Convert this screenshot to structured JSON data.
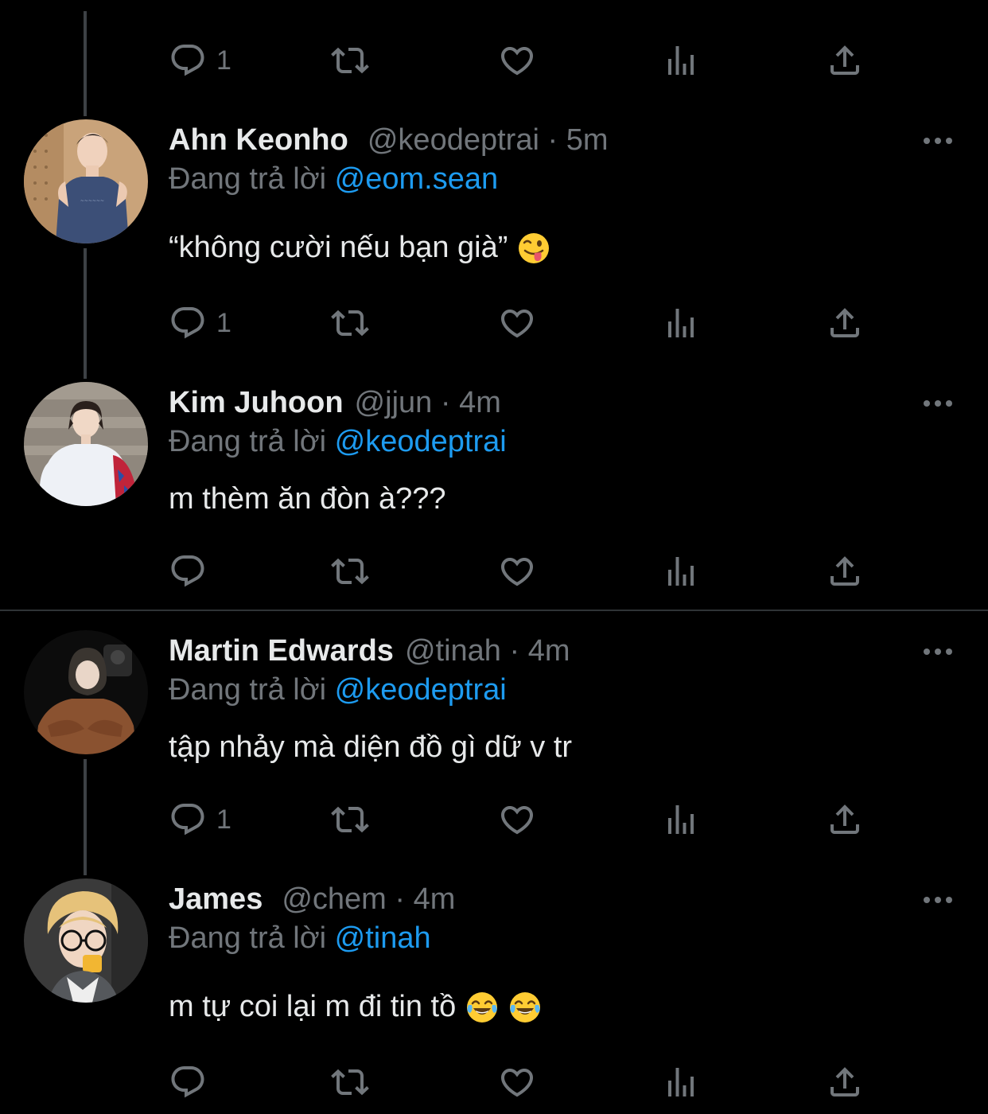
{
  "colors": {
    "background": "#000000",
    "text": "#e7e9ea",
    "muted": "#71767b",
    "accent": "#1d9bf0",
    "thread_line": "#3d4145"
  },
  "icons": [
    "reply-icon",
    "retweet-icon",
    "like-icon",
    "analytics-icon",
    "share-icon",
    "more-icon"
  ],
  "top_actions": {
    "reply_count": "1"
  },
  "tweets": [
    {
      "name": "Ahn Keonho",
      "handle": "@keodeptrai",
      "time": "5m",
      "reply_prefix": "Đang trả lời",
      "reply_to": "@eom.sean",
      "text": "“không cười nếu bạn già”",
      "emojis": [
        "winking-face-with-tongue"
      ],
      "reply_count": "1"
    },
    {
      "name": "Kim Juhoon",
      "handle": "@jjun",
      "time": "4m",
      "reply_prefix": "Đang trả lời",
      "reply_to": "@keodeptrai",
      "text": "m thèm ăn đòn à???",
      "emojis": [],
      "reply_count": ""
    },
    {
      "name": "Martin Edwards",
      "handle": "@tinah",
      "time": "4m",
      "reply_prefix": "Đang trả lời",
      "reply_to": "@keodeptrai",
      "text": "tập nhảy mà diện đồ gì dữ v tr",
      "emojis": [],
      "reply_count": "1"
    },
    {
      "name": "James",
      "handle": "@chem",
      "time": "4m",
      "reply_prefix": "Đang trả lời",
      "reply_to": "@tinah",
      "text": "m tự coi lại m đi tin tồ",
      "emojis": [
        "face-with-tears-of-joy",
        "face-with-tears-of-joy"
      ],
      "reply_count": ""
    }
  ]
}
